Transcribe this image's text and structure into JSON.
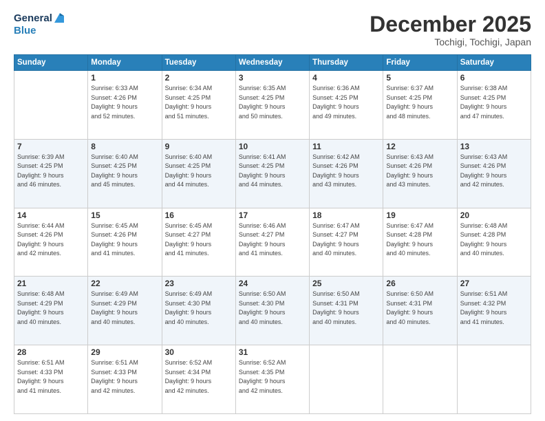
{
  "header": {
    "logo_line1": "General",
    "logo_line2": "Blue",
    "month": "December 2025",
    "location": "Tochigi, Tochigi, Japan"
  },
  "days_of_week": [
    "Sunday",
    "Monday",
    "Tuesday",
    "Wednesday",
    "Thursday",
    "Friday",
    "Saturday"
  ],
  "weeks": [
    [
      {
        "day": "",
        "text": ""
      },
      {
        "day": "1",
        "text": "Sunrise: 6:33 AM\nSunset: 4:26 PM\nDaylight: 9 hours\nand 52 minutes."
      },
      {
        "day": "2",
        "text": "Sunrise: 6:34 AM\nSunset: 4:25 PM\nDaylight: 9 hours\nand 51 minutes."
      },
      {
        "day": "3",
        "text": "Sunrise: 6:35 AM\nSunset: 4:25 PM\nDaylight: 9 hours\nand 50 minutes."
      },
      {
        "day": "4",
        "text": "Sunrise: 6:36 AM\nSunset: 4:25 PM\nDaylight: 9 hours\nand 49 minutes."
      },
      {
        "day": "5",
        "text": "Sunrise: 6:37 AM\nSunset: 4:25 PM\nDaylight: 9 hours\nand 48 minutes."
      },
      {
        "day": "6",
        "text": "Sunrise: 6:38 AM\nSunset: 4:25 PM\nDaylight: 9 hours\nand 47 minutes."
      }
    ],
    [
      {
        "day": "7",
        "text": "Sunrise: 6:39 AM\nSunset: 4:25 PM\nDaylight: 9 hours\nand 46 minutes."
      },
      {
        "day": "8",
        "text": "Sunrise: 6:40 AM\nSunset: 4:25 PM\nDaylight: 9 hours\nand 45 minutes."
      },
      {
        "day": "9",
        "text": "Sunrise: 6:40 AM\nSunset: 4:25 PM\nDaylight: 9 hours\nand 44 minutes."
      },
      {
        "day": "10",
        "text": "Sunrise: 6:41 AM\nSunset: 4:25 PM\nDaylight: 9 hours\nand 44 minutes."
      },
      {
        "day": "11",
        "text": "Sunrise: 6:42 AM\nSunset: 4:26 PM\nDaylight: 9 hours\nand 43 minutes."
      },
      {
        "day": "12",
        "text": "Sunrise: 6:43 AM\nSunset: 4:26 PM\nDaylight: 9 hours\nand 43 minutes."
      },
      {
        "day": "13",
        "text": "Sunrise: 6:43 AM\nSunset: 4:26 PM\nDaylight: 9 hours\nand 42 minutes."
      }
    ],
    [
      {
        "day": "14",
        "text": "Sunrise: 6:44 AM\nSunset: 4:26 PM\nDaylight: 9 hours\nand 42 minutes."
      },
      {
        "day": "15",
        "text": "Sunrise: 6:45 AM\nSunset: 4:26 PM\nDaylight: 9 hours\nand 41 minutes."
      },
      {
        "day": "16",
        "text": "Sunrise: 6:45 AM\nSunset: 4:27 PM\nDaylight: 9 hours\nand 41 minutes."
      },
      {
        "day": "17",
        "text": "Sunrise: 6:46 AM\nSunset: 4:27 PM\nDaylight: 9 hours\nand 41 minutes."
      },
      {
        "day": "18",
        "text": "Sunrise: 6:47 AM\nSunset: 4:27 PM\nDaylight: 9 hours\nand 40 minutes."
      },
      {
        "day": "19",
        "text": "Sunrise: 6:47 AM\nSunset: 4:28 PM\nDaylight: 9 hours\nand 40 minutes."
      },
      {
        "day": "20",
        "text": "Sunrise: 6:48 AM\nSunset: 4:28 PM\nDaylight: 9 hours\nand 40 minutes."
      }
    ],
    [
      {
        "day": "21",
        "text": "Sunrise: 6:48 AM\nSunset: 4:29 PM\nDaylight: 9 hours\nand 40 minutes."
      },
      {
        "day": "22",
        "text": "Sunrise: 6:49 AM\nSunset: 4:29 PM\nDaylight: 9 hours\nand 40 minutes."
      },
      {
        "day": "23",
        "text": "Sunrise: 6:49 AM\nSunset: 4:30 PM\nDaylight: 9 hours\nand 40 minutes."
      },
      {
        "day": "24",
        "text": "Sunrise: 6:50 AM\nSunset: 4:30 PM\nDaylight: 9 hours\nand 40 minutes."
      },
      {
        "day": "25",
        "text": "Sunrise: 6:50 AM\nSunset: 4:31 PM\nDaylight: 9 hours\nand 40 minutes."
      },
      {
        "day": "26",
        "text": "Sunrise: 6:50 AM\nSunset: 4:31 PM\nDaylight: 9 hours\nand 40 minutes."
      },
      {
        "day": "27",
        "text": "Sunrise: 6:51 AM\nSunset: 4:32 PM\nDaylight: 9 hours\nand 41 minutes."
      }
    ],
    [
      {
        "day": "28",
        "text": "Sunrise: 6:51 AM\nSunset: 4:33 PM\nDaylight: 9 hours\nand 41 minutes."
      },
      {
        "day": "29",
        "text": "Sunrise: 6:51 AM\nSunset: 4:33 PM\nDaylight: 9 hours\nand 42 minutes."
      },
      {
        "day": "30",
        "text": "Sunrise: 6:52 AM\nSunset: 4:34 PM\nDaylight: 9 hours\nand 42 minutes."
      },
      {
        "day": "31",
        "text": "Sunrise: 6:52 AM\nSunset: 4:35 PM\nDaylight: 9 hours\nand 42 minutes."
      },
      {
        "day": "",
        "text": ""
      },
      {
        "day": "",
        "text": ""
      },
      {
        "day": "",
        "text": ""
      }
    ]
  ]
}
